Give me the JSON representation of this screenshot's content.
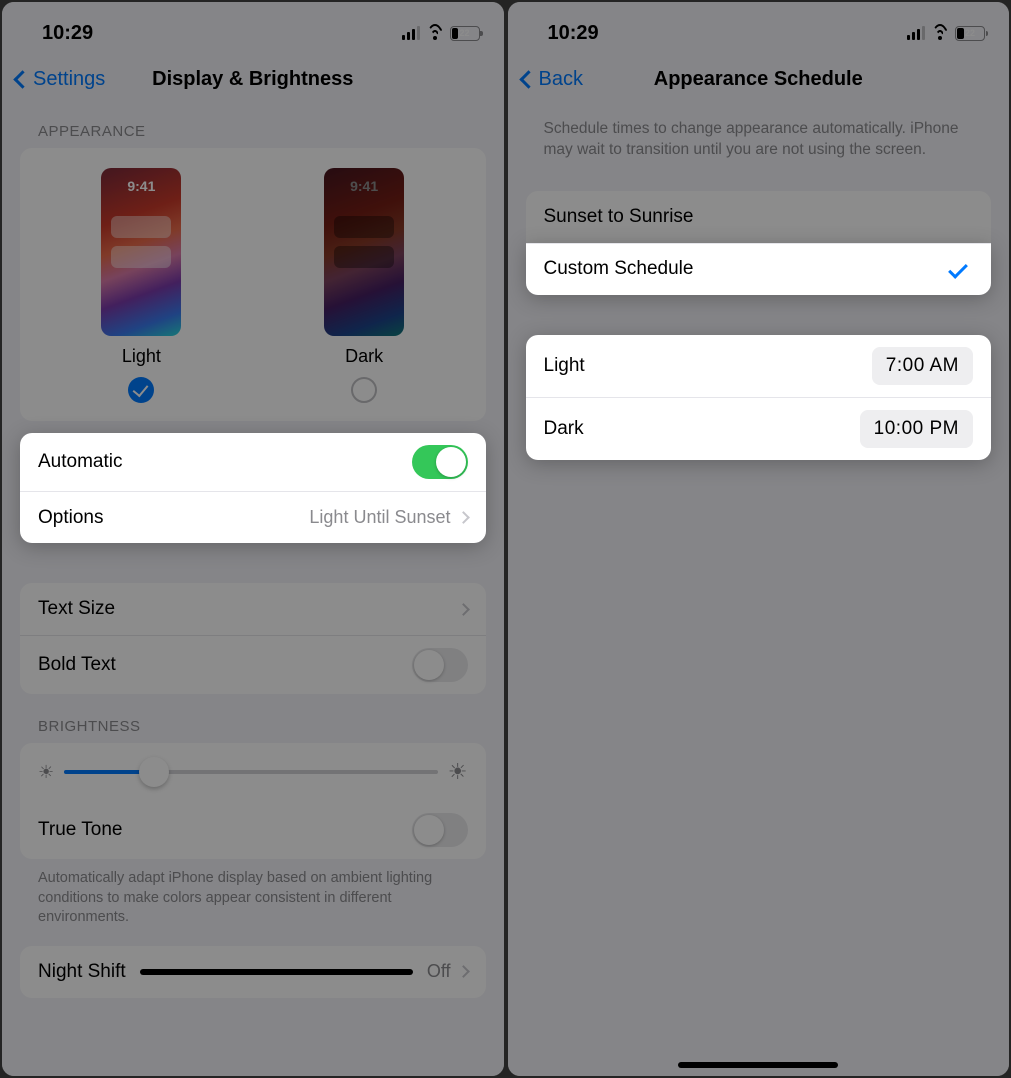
{
  "left": {
    "status_time": "10:29",
    "battery_pct": "22",
    "back_label": "Settings",
    "title": "Display & Brightness",
    "appearance_header": "APPEARANCE",
    "preview_time": "9:41",
    "light_label": "Light",
    "dark_label": "Dark",
    "automatic_label": "Automatic",
    "options_label": "Options",
    "options_value": "Light Until Sunset",
    "text_size_label": "Text Size",
    "bold_text_label": "Bold Text",
    "brightness_header": "BRIGHTNESS",
    "true_tone_label": "True Tone",
    "true_tone_desc": "Automatically adapt iPhone display based on ambient lighting conditions to make colors appear consistent in different environments.",
    "night_shift_label": "Night Shift",
    "night_shift_value": "Off"
  },
  "right": {
    "status_time": "10:29",
    "battery_pct": "22",
    "back_label": "Back",
    "title": "Appearance Schedule",
    "desc": "Schedule times to change appearance automatically. iPhone may wait to transition until you are not using the screen.",
    "sunset_label": "Sunset to Sunrise",
    "custom_label": "Custom Schedule",
    "light_label": "Light",
    "light_time": "7:00 AM",
    "dark_label": "Dark",
    "dark_time": "10:00 PM"
  }
}
